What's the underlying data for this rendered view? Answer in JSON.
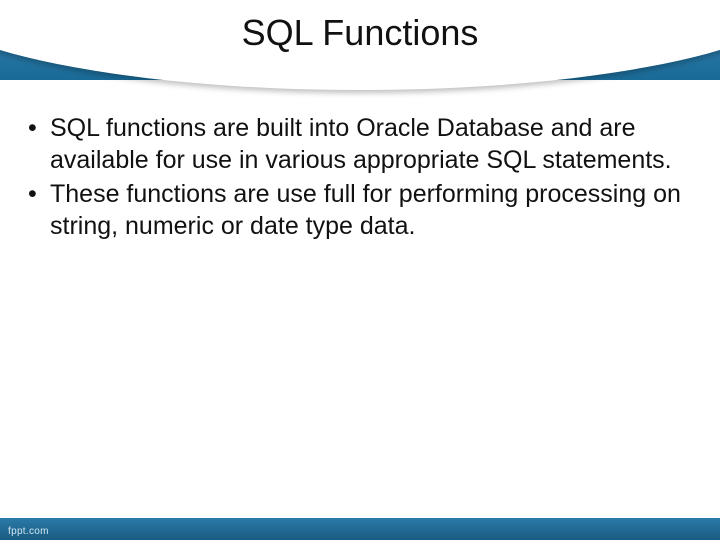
{
  "slide": {
    "title": "SQL Functions",
    "bullets": [
      "SQL functions are built into Oracle Database and are available for use in various appropriate SQL statements.",
      "These functions are use full for performing processing on string, numeric or date type data."
    ],
    "footer": "fppt.com"
  }
}
